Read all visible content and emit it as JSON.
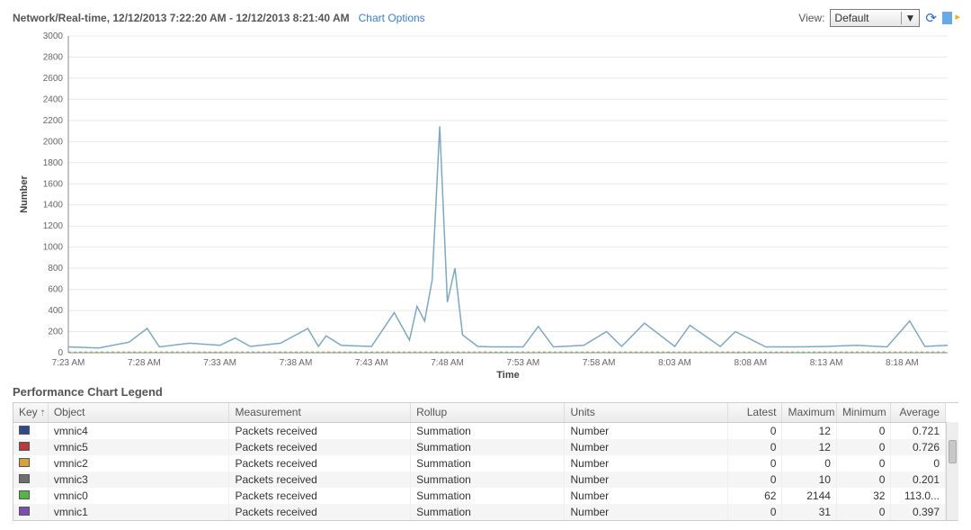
{
  "toolbar": {
    "title": "Network/Real-time, 12/12/2013 7:22:20 AM - 12/12/2013 8:21:40 AM",
    "chart_options": "Chart Options",
    "view_label": "View:",
    "view_value": "Default"
  },
  "legend_heading": "Performance Chart Legend",
  "columns": {
    "key": "Key",
    "object": "Object",
    "measurement": "Measurement",
    "rollup": "Rollup",
    "units": "Units",
    "latest": "Latest",
    "maximum": "Maximum",
    "minimum": "Minimum",
    "average": "Average"
  },
  "rows": [
    {
      "swatch": "#2e4a8a",
      "object": "vmnic4",
      "measurement": "Packets received",
      "rollup": "Summation",
      "units": "Number",
      "latest": "0",
      "maximum": "12",
      "minimum": "0",
      "average": "0.721"
    },
    {
      "swatch": "#b83b3b",
      "object": "vmnic5",
      "measurement": "Packets received",
      "rollup": "Summation",
      "units": "Number",
      "latest": "0",
      "maximum": "12",
      "minimum": "0",
      "average": "0.726"
    },
    {
      "swatch": "#d7a23b",
      "object": "vmnic2",
      "measurement": "Packets received",
      "rollup": "Summation",
      "units": "Number",
      "latest": "0",
      "maximum": "0",
      "minimum": "0",
      "average": "0"
    },
    {
      "swatch": "#6e6e6e",
      "object": "vmnic3",
      "measurement": "Packets received",
      "rollup": "Summation",
      "units": "Number",
      "latest": "0",
      "maximum": "10",
      "minimum": "0",
      "average": "0.201"
    },
    {
      "swatch": "#58b24a",
      "object": "vmnic0",
      "measurement": "Packets received",
      "rollup": "Summation",
      "units": "Number",
      "latest": "62",
      "maximum": "2144",
      "minimum": "32",
      "average": "113.0..."
    },
    {
      "swatch": "#7a4fb0",
      "object": "vmnic1",
      "measurement": "Packets received",
      "rollup": "Summation",
      "units": "Number",
      "latest": "0",
      "maximum": "31",
      "minimum": "0",
      "average": "0.397"
    }
  ],
  "chart_data": {
    "type": "line",
    "title": "Network/Real-time",
    "xlabel": "Time",
    "ylabel": "Number",
    "ylim": [
      0,
      3000
    ],
    "x_ticks": [
      "7:23 AM",
      "7:28 AM",
      "7:33 AM",
      "7:38 AM",
      "7:43 AM",
      "7:48 AM",
      "7:53 AM",
      "7:58 AM",
      "8:03 AM",
      "8:08 AM",
      "8:13 AM",
      "8:18 AM"
    ],
    "y_ticks": [
      0,
      200,
      400,
      600,
      800,
      1000,
      1200,
      1400,
      1600,
      1800,
      2000,
      2200,
      2400,
      2600,
      2800,
      3000
    ],
    "primary_series_name": "vmnic0",
    "series": [
      {
        "name": "vmnic0",
        "x_minutes_from_start": [
          0,
          2,
          4,
          5.2,
          6,
          8,
          10,
          11,
          12,
          14,
          15.8,
          16.5,
          17,
          18,
          20,
          21.5,
          22.5,
          23,
          23.5,
          24,
          24.5,
          25,
          25.5,
          26,
          27,
          28,
          30,
          31,
          32,
          34,
          35.5,
          36.5,
          38,
          40,
          41,
          43,
          44,
          46,
          48,
          50,
          52,
          54,
          55.5,
          56.5,
          58
        ],
        "values": [
          55,
          45,
          100,
          230,
          55,
          90,
          70,
          140,
          60,
          90,
          230,
          60,
          160,
          70,
          60,
          380,
          120,
          440,
          300,
          690,
          2144,
          480,
          800,
          170,
          60,
          55,
          55,
          250,
          55,
          70,
          200,
          60,
          280,
          60,
          260,
          60,
          200,
          55,
          55,
          60,
          70,
          55,
          300,
          60,
          70
        ]
      },
      {
        "name": "vmnic1",
        "x_minutes_from_start": [
          0,
          58
        ],
        "values": [
          0,
          0
        ]
      },
      {
        "name": "vmnic2",
        "x_minutes_from_start": [
          0,
          58
        ],
        "values": [
          0,
          0
        ]
      },
      {
        "name": "vmnic3",
        "x_minutes_from_start": [
          0,
          58
        ],
        "values": [
          0,
          0
        ]
      },
      {
        "name": "vmnic4",
        "x_minutes_from_start": [
          0,
          58
        ],
        "values": [
          0,
          0
        ]
      },
      {
        "name": "vmnic5",
        "x_minutes_from_start": [
          0,
          58
        ],
        "values": [
          0,
          0
        ]
      }
    ]
  }
}
